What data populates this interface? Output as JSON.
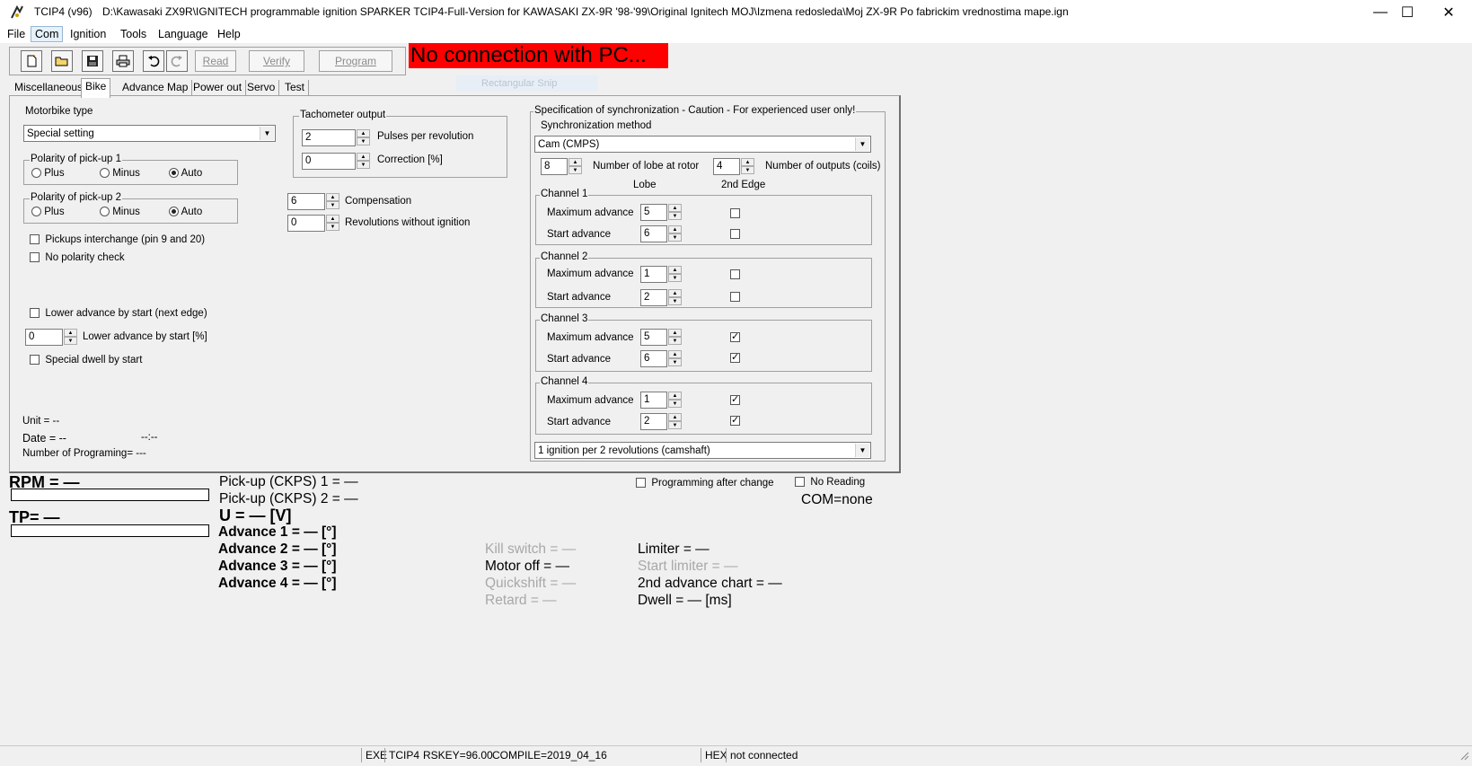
{
  "window": {
    "title": "TCIP4 (v96)",
    "path": "D:\\Kawasaki ZX9R\\IGNITECH programmable ignition SPARKER TCIP4-Full-Version for KAWASAKI ZX-9R '98-'99\\Original Ignitech MOJ\\Izmena redosleda\\Moj ZX-9R Po fabrickim vrednostima mape.ign",
    "minimize": "—",
    "maximize": "☐",
    "close": "✕"
  },
  "menu": [
    "File",
    "Com",
    "Ignition",
    "Tools",
    "Language",
    "Help"
  ],
  "toolbar": {
    "read": "Read",
    "verify": "Verify",
    "program": "Program"
  },
  "banner": "No connection with PC...",
  "ghost_snip": "Rectangular Snip",
  "tabs": [
    "Miscellaneous",
    "Bike",
    "Advance Map",
    "Power out",
    "Servo",
    "Test"
  ],
  "left": {
    "motorbike_type_label": "Motorbike type",
    "motorbike_type_value": "Special setting",
    "polarity1_title": "Polarity of pick-up 1",
    "polarity2_title": "Polarity of pick-up 2",
    "radio_plus": "Plus",
    "radio_minus": "Minus",
    "radio_auto": "Auto",
    "pickups_interchange": "Pickups interchange (pin 9 and 20)",
    "no_polarity_check": "No polarity check",
    "lower_advance_next_edge": "Lower advance by start (next edge)",
    "lower_advance_pct_value": "0",
    "lower_advance_pct_label": "Lower advance by start [%]",
    "special_dwell": "Special dwell by start",
    "unit": "Unit = --",
    "date": "Date = --",
    "time": "--:--",
    "num_programming": "Number of Programing= ---"
  },
  "middle": {
    "tach_title": "Tachometer output",
    "pulses_value": "2",
    "pulses_label": "Pulses per revolution",
    "correction_value": "0",
    "correction_label": "Correction [%]",
    "compensation_value": "6",
    "compensation_label": "Compensation",
    "rev_without_ign_value": "0",
    "rev_without_ign_label": "Revolutions without ignition"
  },
  "sync": {
    "title": "Specification of synchronization - Caution - For experienced user only!",
    "method_label": "Synchronization method",
    "method_value": "Cam (CMPS)",
    "lobe_value": "8",
    "lobe_label": "Number of lobe at rotor",
    "outputs_value": "4",
    "outputs_label": "Number of outputs (coils)",
    "col_lobe": "Lobe",
    "col_edge": "2nd Edge",
    "max_adv_label": "Maximum advance",
    "start_adv_label": "Start advance",
    "channels": [
      {
        "name": "Channel 1",
        "max": "5",
        "start": "6",
        "max_checked": false,
        "start_checked": false
      },
      {
        "name": "Channel 2",
        "max": "1",
        "start": "2",
        "max_checked": false,
        "start_checked": false
      },
      {
        "name": "Channel 3",
        "max": "5",
        "start": "6",
        "max_checked": true,
        "start_checked": true
      },
      {
        "name": "Channel 4",
        "max": "1",
        "start": "2",
        "max_checked": true,
        "start_checked": true
      }
    ],
    "ignition_mode": "1 ignition per 2 revolutions (camshaft)"
  },
  "monitor": {
    "rpm": "RPM = —",
    "tp": "TP= —",
    "pickup1": "Pick-up (CKPS) 1 = —",
    "pickup2": "Pick-up (CKPS) 2 = —",
    "voltage": "U = — [V]",
    "adv1": "Advance 1 = — [°]",
    "adv2": "Advance 2 = — [°]",
    "adv3": "Advance 3 = — [°]",
    "adv4": "Advance 4 = — [°]",
    "kill_switch": "Kill switch = —",
    "motor_off": "Motor off = —",
    "quickshift": "Quickshift = —",
    "retard": "Retard = —",
    "limiter": "Limiter = —",
    "start_limiter": "Start limiter = —",
    "second_adv_chart": "2nd advance chart = —",
    "dwell": "Dwell = — [ms]",
    "prog_after_change": "Programming after change",
    "no_reading": "No Reading",
    "com": "COM=none"
  },
  "status": {
    "exe": "EXE",
    "tcip": "TCIP4",
    "rskey": "RSKEY=96.00",
    "compile": "COMPILE=2019_04_16",
    "hex": "HEX",
    "conn": "not connected"
  }
}
